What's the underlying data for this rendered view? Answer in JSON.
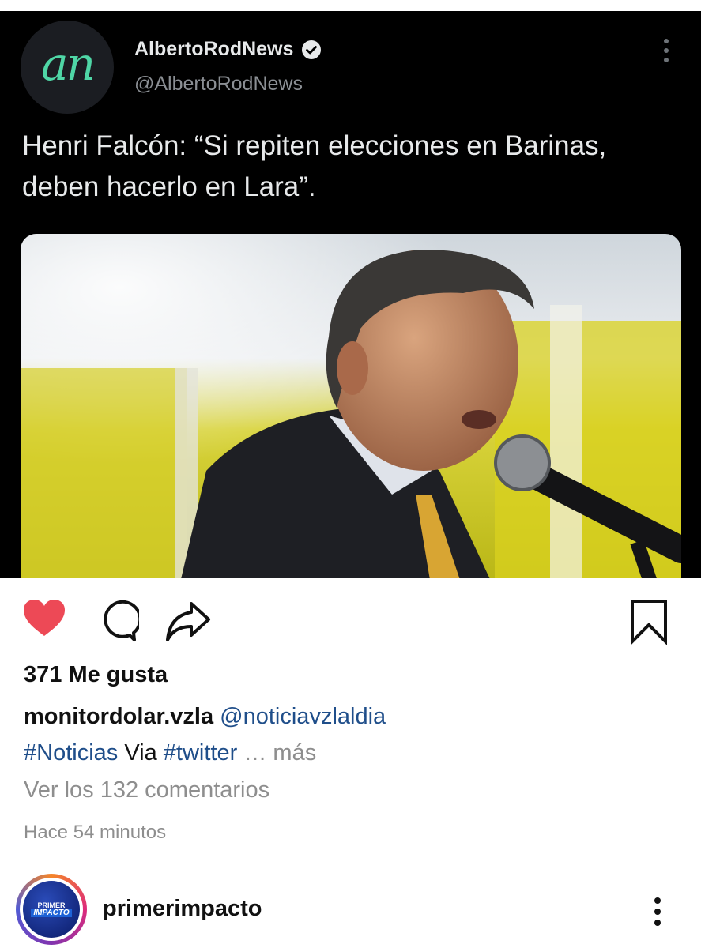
{
  "tweet": {
    "avatar_letters": "an",
    "display_name": "AlbertoRodNews",
    "handle": "@AlbertoRodNews",
    "text": "Henri Falcón: “Si repiten elecciones en Barinas, deben hacerlo en Lara”.",
    "icons": {
      "verified": "verified-badge-icon",
      "more": "more-vertical-icon"
    }
  },
  "post": {
    "likes_label": "371 Me gusta",
    "caption_user": "monitordolar.vzla",
    "caption_mention": "@noticiavzlaldia",
    "caption_hashtag1": "#Noticias",
    "caption_via": "Via",
    "caption_hashtag2": "#twitter",
    "caption_ellipsis": "…",
    "caption_more": "más",
    "view_comments": "Ver los 132 comentarios",
    "timestamp": "Hace 54 minutos",
    "icons": {
      "like": "heart-icon",
      "comment": "comment-icon",
      "share": "share-icon",
      "save": "bookmark-icon"
    },
    "colors": {
      "like_red": "#ed4956",
      "link_blue": "#1f4e8a",
      "muted": "#8e8e8e"
    }
  },
  "next_post": {
    "avatar_line1": "PRIMER",
    "avatar_line2": "IMPACTO",
    "username": "primerimpacto"
  }
}
